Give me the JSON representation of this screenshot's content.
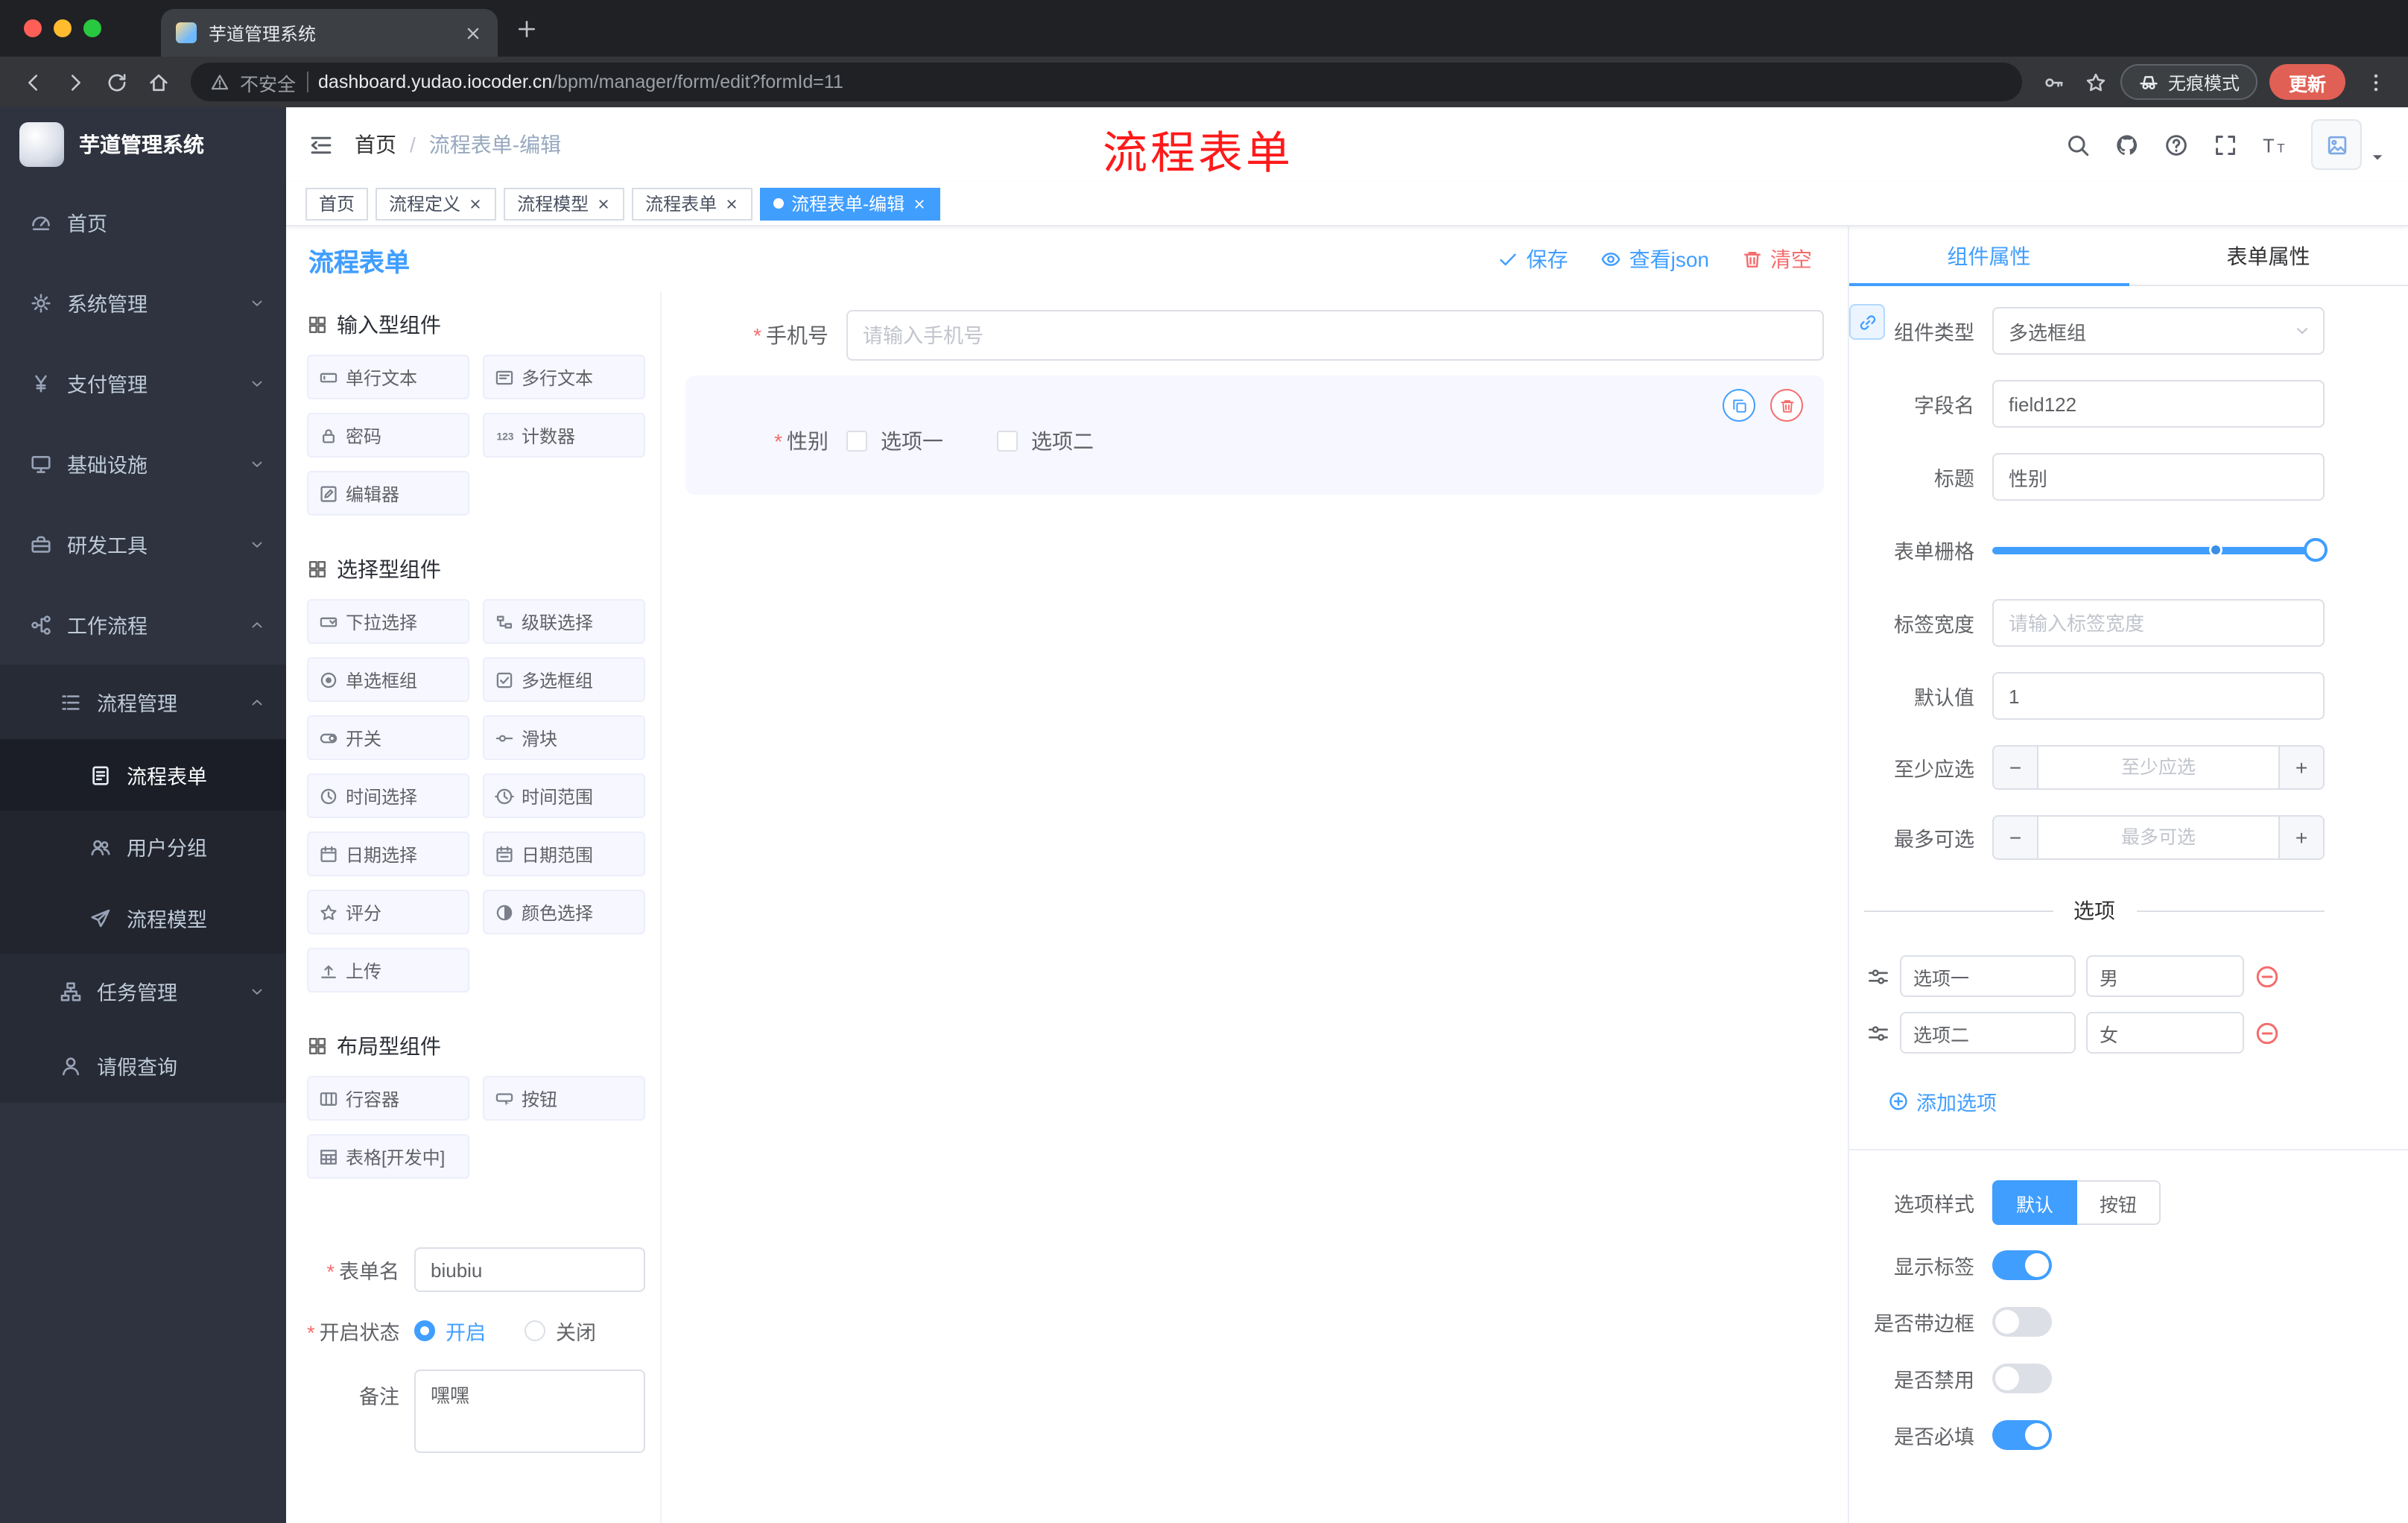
{
  "browser": {
    "tab_title": "芋道管理系统",
    "security_label": "不安全",
    "url_host": "dashboard.yudao.iocoder.cn",
    "url_path": "/bpm/manager/form/edit?formId=11",
    "incognito_label": "无痕模式",
    "update_label": "更新",
    "toolbar_icons": [
      "back",
      "forward",
      "reload",
      "home",
      "key",
      "star",
      "incognito",
      "menu-dots"
    ]
  },
  "header": {
    "logo_title": "芋道管理系统",
    "breadcrumb_home": "首页",
    "breadcrumb_current": "流程表单-编辑",
    "annotation": "流程表单",
    "action_icons": [
      "search",
      "github",
      "help",
      "fullscreen",
      "font-size",
      "avatar",
      "caret-down"
    ]
  },
  "tags": {
    "items": [
      {
        "label": "首页",
        "active": false,
        "closable": false
      },
      {
        "label": "流程定义",
        "active": false,
        "closable": true
      },
      {
        "label": "流程模型",
        "active": false,
        "closable": true
      },
      {
        "label": "流程表单",
        "active": false,
        "closable": true
      },
      {
        "label": "流程表单-编辑",
        "active": true,
        "closable": true
      }
    ]
  },
  "sidebar": {
    "items": [
      {
        "label": "首页",
        "icon": "dashboard",
        "level": 0
      },
      {
        "label": "系统管理",
        "icon": "gear",
        "level": 0,
        "expanded": false
      },
      {
        "label": "支付管理",
        "icon": "yen",
        "level": 0,
        "expanded": false
      },
      {
        "label": "基础设施",
        "icon": "monitor",
        "level": 0,
        "expanded": false
      },
      {
        "label": "研发工具",
        "icon": "toolbox",
        "level": 0,
        "expanded": false
      },
      {
        "label": "工作流程",
        "icon": "workflow",
        "level": 0,
        "expanded": true
      },
      {
        "label": "流程管理",
        "icon": "list",
        "level": 1,
        "expanded": true
      },
      {
        "label": "流程表单",
        "icon": "document",
        "level": 2,
        "active": true
      },
      {
        "label": "用户分组",
        "icon": "users",
        "level": 2
      },
      {
        "label": "流程模型",
        "icon": "send",
        "level": 2
      },
      {
        "label": "任务管理",
        "icon": "tree",
        "level": 1,
        "expanded": false
      },
      {
        "label": "请假查询",
        "icon": "person",
        "level": 1
      }
    ]
  },
  "designer": {
    "title": "流程表单",
    "save_label": "保存",
    "view_json_label": "查看json",
    "clear_label": "清空"
  },
  "library": {
    "groups": [
      {
        "title": "输入型组件",
        "items": [
          {
            "label": "单行文本",
            "icon": "input"
          },
          {
            "label": "多行文本",
            "icon": "textarea"
          },
          {
            "label": "密码",
            "icon": "lock"
          },
          {
            "label": "计数器",
            "icon": "counter"
          },
          {
            "label": "编辑器",
            "icon": "editor"
          }
        ]
      },
      {
        "title": "选择型组件",
        "items": [
          {
            "label": "下拉选择",
            "icon": "select"
          },
          {
            "label": "级联选择",
            "icon": "cascader"
          },
          {
            "label": "单选框组",
            "icon": "radio"
          },
          {
            "label": "多选框组",
            "icon": "checkbox"
          },
          {
            "label": "开关",
            "icon": "switch"
          },
          {
            "label": "滑块",
            "icon": "slider"
          },
          {
            "label": "时间选择",
            "icon": "time"
          },
          {
            "label": "时间范围",
            "icon": "time-range"
          },
          {
            "label": "日期选择",
            "icon": "date"
          },
          {
            "label": "日期范围",
            "icon": "date-range"
          },
          {
            "label": "评分",
            "icon": "star"
          },
          {
            "label": "颜色选择",
            "icon": "color"
          },
          {
            "label": "上传",
            "icon": "upload"
          }
        ]
      },
      {
        "title": "布局型组件",
        "items": [
          {
            "label": "行容器",
            "icon": "row"
          },
          {
            "label": "按钮",
            "icon": "button"
          },
          {
            "label": "表格[开发中]",
            "icon": "table"
          }
        ]
      }
    ]
  },
  "form_meta": {
    "name_label": "表单名",
    "name_value": "biubiu",
    "status_label": "开启状态",
    "status_on": "开启",
    "status_off": "关闭",
    "status_selected": "开启",
    "remark_label": "备注",
    "remark_value": "嘿嘿"
  },
  "canvas": {
    "phone_label": "手机号",
    "phone_required": true,
    "phone_placeholder": "请输入手机号",
    "gender_label": "性别",
    "gender_required": true,
    "gender_option1": "选项一",
    "gender_option2": "选项二"
  },
  "properties": {
    "tab_component": "组件属性",
    "tab_form": "表单属性",
    "active_tab": "组件属性",
    "rows": {
      "type_label": "组件类型",
      "type_value": "多选框组",
      "field_label": "字段名",
      "field_value": "field122",
      "title_label": "标题",
      "title_value": "性别",
      "grid_label": "表单栅格",
      "labelwidth_label": "标签宽度",
      "labelwidth_placeholder": "请输入标签宽度",
      "default_label": "默认值",
      "default_value": "1",
      "min_label": "至少应选",
      "min_placeholder": "至少应选",
      "max_label": "最多可选",
      "max_placeholder": "最多可选"
    },
    "options_title": "选项",
    "options": [
      {
        "label": "选项一",
        "value": "男"
      },
      {
        "label": "选项二",
        "value": "女"
      }
    ],
    "add_option_label": "添加选项",
    "style_label": "选项样式",
    "style_default": "默认",
    "style_button": "按钮",
    "style_selected": "默认",
    "show_label": "显示标签",
    "show_on": true,
    "border_label": "是否带边框",
    "border_on": false,
    "disabled_label": "是否禁用",
    "disabled_on": false,
    "required_label": "是否必填",
    "required_on": true
  },
  "colors": {
    "accent": "#409eff",
    "danger": "#f56c6c",
    "annotation_red": "#fe1a1a",
    "sidebar_bg": "#2e333f",
    "tab_active_bg": "#409eff"
  }
}
